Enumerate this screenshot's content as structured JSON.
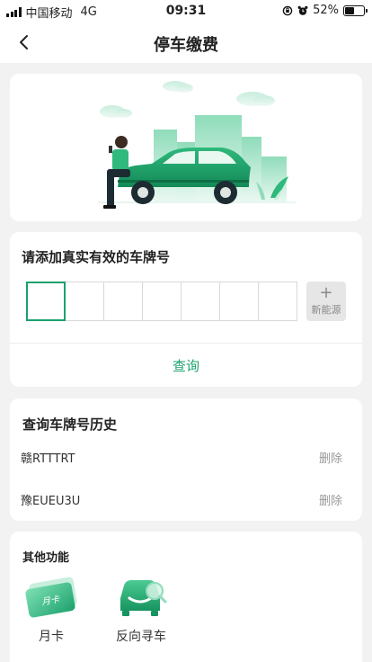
{
  "status_bar": {
    "carrier": "中国移动",
    "network": "4G",
    "time": "09:31",
    "battery": "52%"
  },
  "nav": {
    "title": "停车缴费"
  },
  "plate_input": {
    "title": "请添加真实有效的车牌号",
    "new_energy_plus": "+",
    "new_energy_label": "新能源",
    "query_label": "查询"
  },
  "history": {
    "title": "查询车牌号历史",
    "items": [
      {
        "plate": "赣RTTTRT",
        "delete_label": "删除"
      },
      {
        "plate": "豫EUEU3U",
        "delete_label": "删除"
      }
    ]
  },
  "functions": {
    "title": "其他功能",
    "items": [
      {
        "label": "月卡",
        "card_text": "月卡"
      },
      {
        "label": "反向寻车"
      }
    ]
  },
  "colors": {
    "accent": "#1ba16d",
    "page_bg": "#f2f2f2"
  }
}
